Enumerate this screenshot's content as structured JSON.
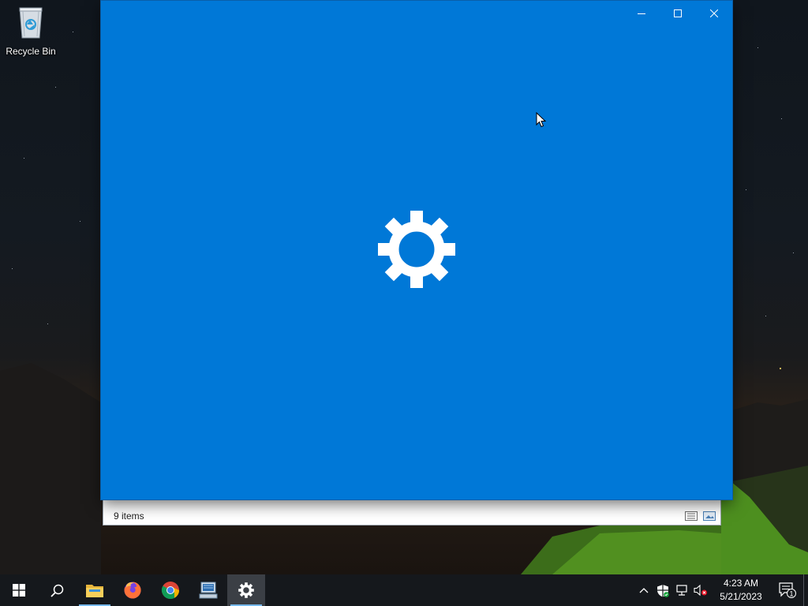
{
  "desktop": {
    "icons": [
      {
        "label": "Recycle Bin",
        "icon": "recycle-bin-icon"
      }
    ]
  },
  "explorer": {
    "status_text": "9 items",
    "view_buttons": [
      "details-view-icon",
      "large-icons-view-icon"
    ]
  },
  "settings_window": {
    "background": "#0078d7",
    "splash_icon": "gear-icon",
    "caption_buttons": [
      "minimize-icon",
      "maximize-icon",
      "close-icon"
    ]
  },
  "taskbar": {
    "background": "#15181c",
    "buttons": [
      {
        "name": "start-button",
        "icon": "windows-logo-icon"
      },
      {
        "name": "search-button",
        "icon": "search-icon"
      },
      {
        "name": "file-explorer-button",
        "icon": "folder-icon"
      },
      {
        "name": "firefox-button",
        "icon": "firefox-icon"
      },
      {
        "name": "chrome-button",
        "icon": "chrome-icon"
      },
      {
        "name": "remote-desktop-button",
        "icon": "computer-network-icon"
      },
      {
        "name": "settings-button",
        "icon": "gear-icon",
        "active": true
      }
    ],
    "tray": {
      "icons": [
        "chevron-up-icon",
        "security-shield-icon",
        "network-icon",
        "volume-muted-icon"
      ],
      "time": "4:23 AM",
      "date": "5/21/2023",
      "notification_count": "1"
    }
  }
}
